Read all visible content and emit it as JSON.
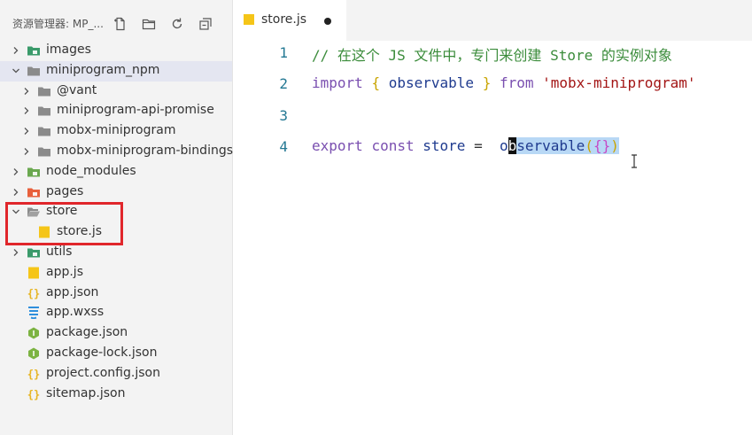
{
  "explorer": {
    "title": "资源管理器: MP_...",
    "actions": [
      "new-file-icon",
      "new-folder-icon",
      "refresh-icon",
      "collapse-all-icon"
    ],
    "items": [
      {
        "label": "images",
        "depth": 0,
        "kind": "folder",
        "icon": "folder-images-icon",
        "color": "#3a9a6a",
        "expanded": false
      },
      {
        "label": "miniprogram_npm",
        "depth": 0,
        "kind": "folder",
        "icon": "folder-icon",
        "color": "#8b8b8b",
        "expanded": true
      },
      {
        "label": "@vant",
        "depth": 1,
        "kind": "folder",
        "icon": "folder-icon",
        "color": "#8b8b8b",
        "expanded": false
      },
      {
        "label": "miniprogram-api-promise",
        "depth": 1,
        "kind": "folder",
        "icon": "folder-icon",
        "color": "#8b8b8b",
        "expanded": false
      },
      {
        "label": "mobx-miniprogram",
        "depth": 1,
        "kind": "folder",
        "icon": "folder-icon",
        "color": "#8b8b8b",
        "expanded": false
      },
      {
        "label": "mobx-miniprogram-bindings",
        "depth": 1,
        "kind": "folder",
        "icon": "folder-icon",
        "color": "#8b8b8b",
        "expanded": false
      },
      {
        "label": "node_modules",
        "depth": 0,
        "kind": "folder",
        "icon": "folder-node-icon",
        "color": "#6aa84f",
        "expanded": false
      },
      {
        "label": "pages",
        "depth": 0,
        "kind": "folder",
        "icon": "folder-pages-icon",
        "color": "#e8603c",
        "expanded": false
      },
      {
        "label": "store",
        "depth": 0,
        "kind": "folder",
        "icon": "folder-open-icon",
        "color": "#8b8b8b",
        "expanded": true
      },
      {
        "label": "store.js",
        "depth": 1,
        "kind": "file",
        "icon": "js-file-icon",
        "color": "#f5c518"
      },
      {
        "label": "utils",
        "depth": 0,
        "kind": "folder",
        "icon": "folder-utils-icon",
        "color": "#3a9a6a",
        "expanded": false
      },
      {
        "label": "app.js",
        "depth": 0,
        "kind": "file",
        "icon": "js-file-icon",
        "color": "#f5c518"
      },
      {
        "label": "app.json",
        "depth": 0,
        "kind": "file",
        "icon": "json-file-icon",
        "color": "#e6b422"
      },
      {
        "label": "app.wxss",
        "depth": 0,
        "kind": "file",
        "icon": "css-file-icon",
        "color": "#2f8fdc"
      },
      {
        "label": "package.json",
        "depth": 0,
        "kind": "file",
        "icon": "npm-file-icon",
        "color": "#7cb342"
      },
      {
        "label": "package-lock.json",
        "depth": 0,
        "kind": "file",
        "icon": "npm-file-icon",
        "color": "#7cb342"
      },
      {
        "label": "project.config.json",
        "depth": 0,
        "kind": "file",
        "icon": "json-file-icon",
        "color": "#e6b422"
      },
      {
        "label": "sitemap.json",
        "depth": 0,
        "kind": "file",
        "icon": "json-file-icon",
        "color": "#e6b422"
      }
    ]
  },
  "editor": {
    "tab": {
      "label": "store.js",
      "modified": true
    },
    "lines": [
      {
        "num": "1",
        "comment": "// 在这个 JS 文件中，专门来创建 Store 的实例对象"
      },
      {
        "num": "2",
        "kw_import": "import",
        "brace_open": "{",
        "name": "observable",
        "brace_close": "}",
        "kw_from": "from",
        "module": "'mobx-miniprogram'"
      },
      {
        "num": "3"
      },
      {
        "num": "4",
        "kw_export": "export",
        "kw_const": "const",
        "var": "store",
        "op": "=",
        "call_pre": "o",
        "call_cursor": "b",
        "call_rest": "servable",
        "paren_open": "(",
        "obj": "{}",
        "paren_close": ")"
      }
    ]
  }
}
